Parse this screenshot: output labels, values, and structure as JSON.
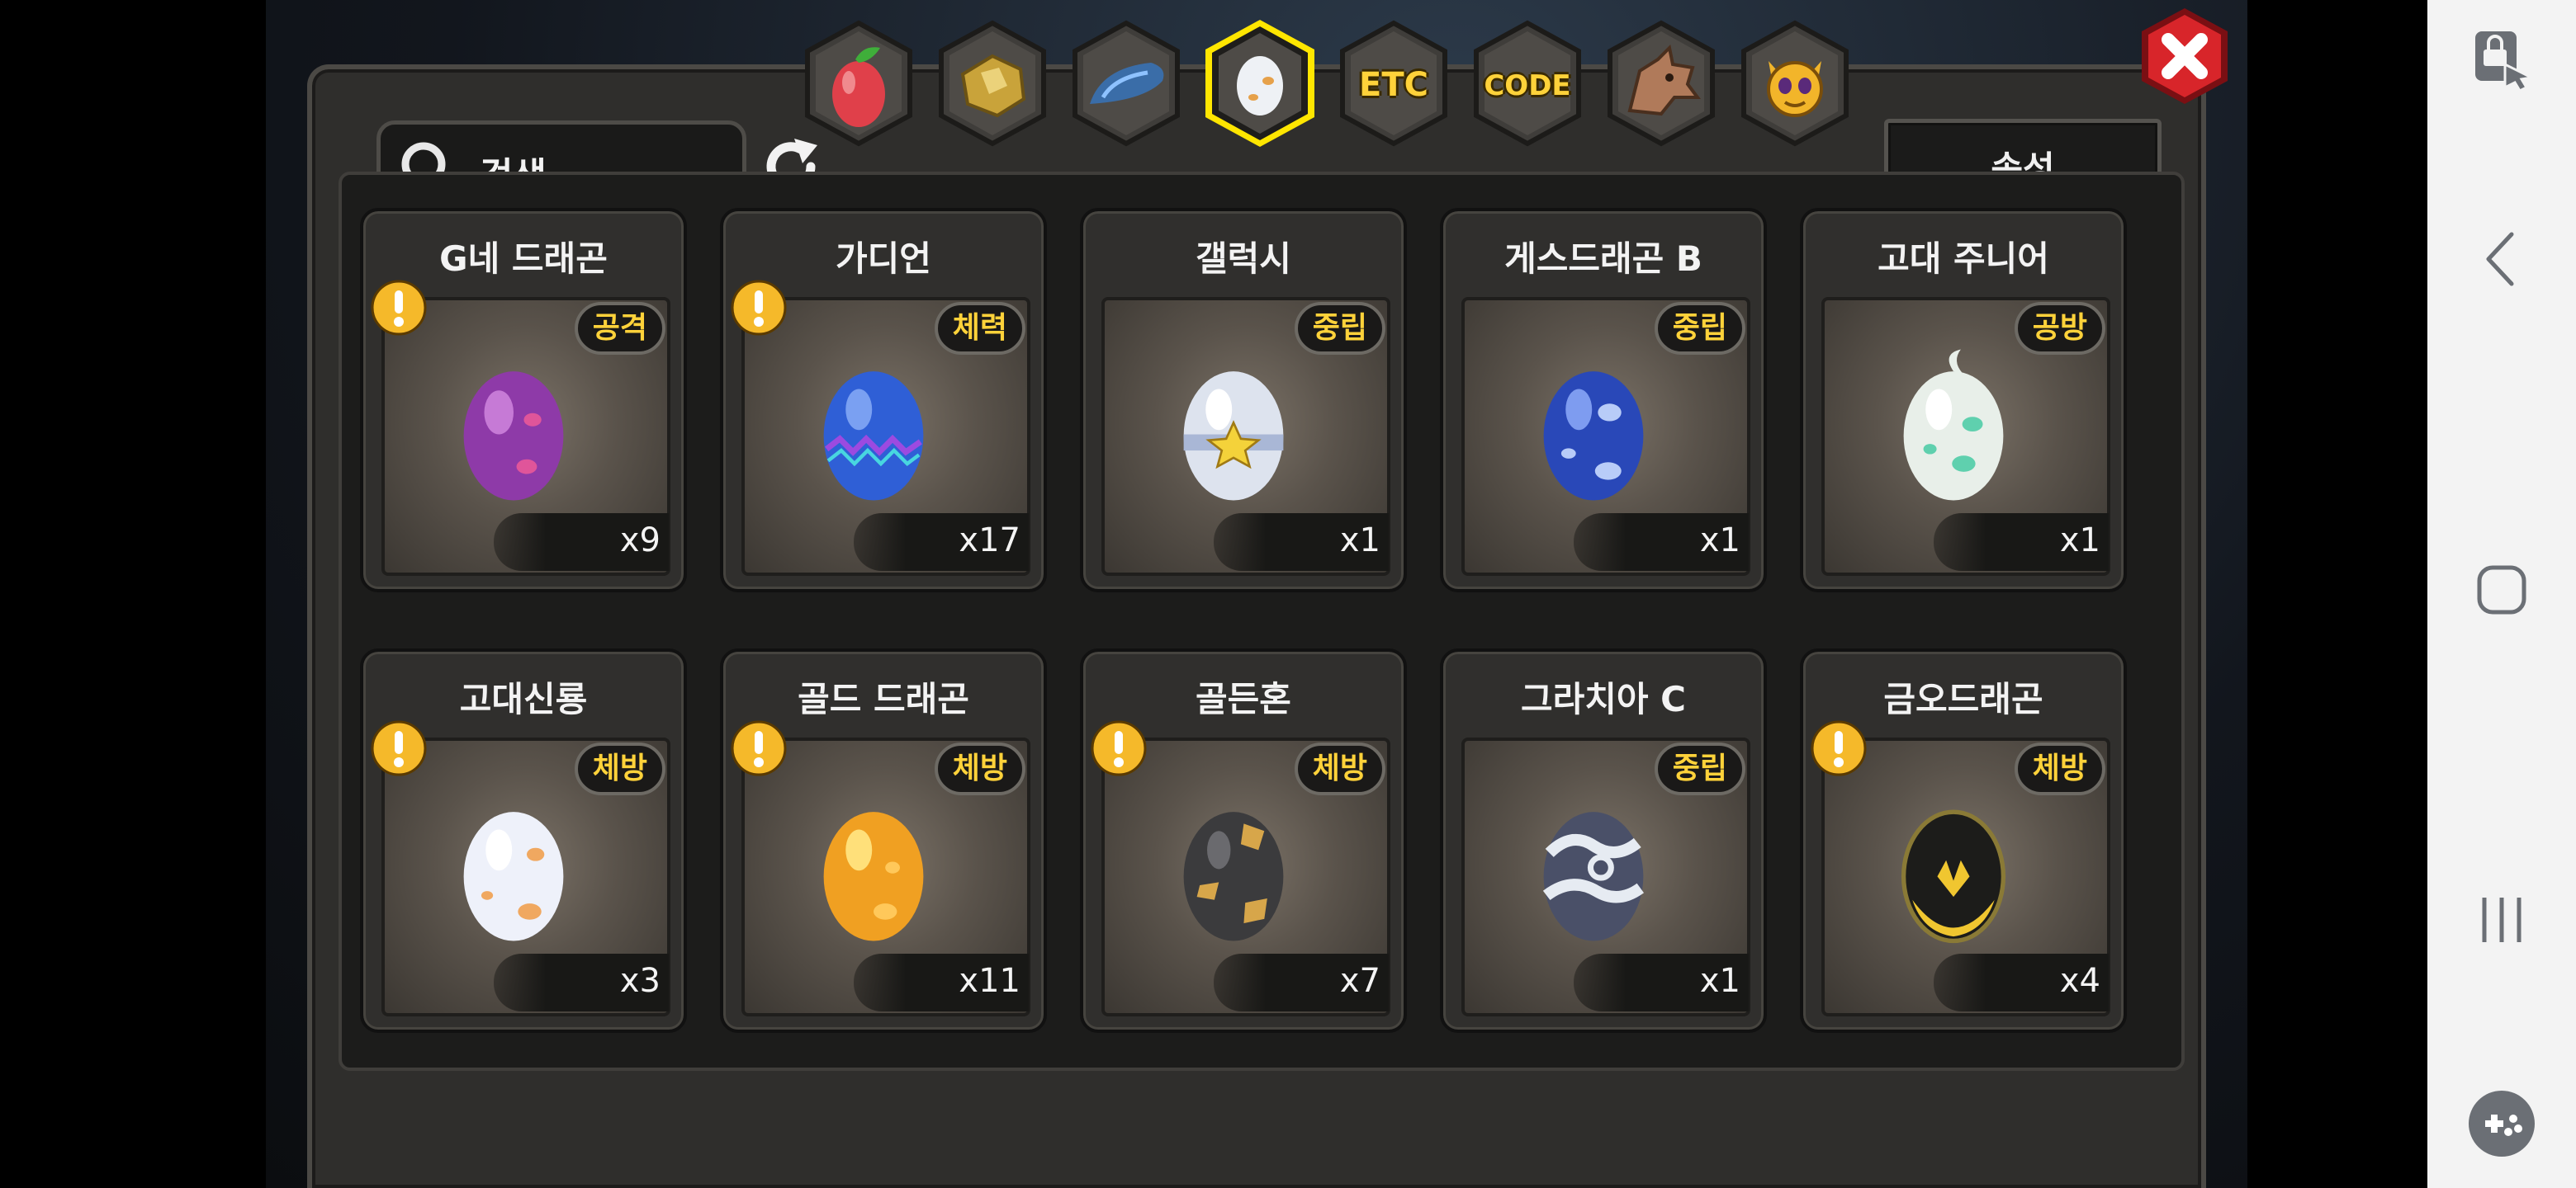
{
  "search": {
    "label": "검색"
  },
  "attribute_button": {
    "label": "속성"
  },
  "tabs": [
    {
      "name": "fruit",
      "icon": "fruit-icon",
      "selected": false
    },
    {
      "name": "gold-ore",
      "icon": "gold-nugget-icon",
      "selected": false
    },
    {
      "name": "dragon-scale",
      "icon": "dragon-scale-icon",
      "selected": false
    },
    {
      "name": "egg",
      "icon": "egg-icon",
      "selected": true
    },
    {
      "name": "etc",
      "label": "ETC",
      "selected": false
    },
    {
      "name": "code",
      "label": "CODE",
      "selected": false
    },
    {
      "name": "dragon",
      "icon": "dragon-head-icon",
      "selected": false
    },
    {
      "name": "mascot",
      "icon": "mascot-face-icon",
      "selected": false
    }
  ],
  "items": [
    {
      "name": "G네 드래곤",
      "attr": "공격",
      "count": "x9",
      "warning": true,
      "egg": "purple"
    },
    {
      "name": "가디언",
      "attr": "체력",
      "count": "x17",
      "warning": true,
      "egg": "blue-zigzag"
    },
    {
      "name": "갤럭시",
      "attr": "중립",
      "count": "x1",
      "warning": false,
      "egg": "white-star"
    },
    {
      "name": "게스드래곤 B",
      "attr": "중립",
      "count": "x1",
      "warning": false,
      "egg": "blue-spotted"
    },
    {
      "name": "고대 주니어",
      "attr": "공방",
      "count": "x1",
      "warning": false,
      "egg": "white-teal"
    },
    {
      "name": "고대신룡",
      "attr": "체방",
      "count": "x3",
      "warning": true,
      "egg": "white-orange"
    },
    {
      "name": "골드 드래곤",
      "attr": "체방",
      "count": "x11",
      "warning": true,
      "egg": "gold"
    },
    {
      "name": "골든혼",
      "attr": "체방",
      "count": "x7",
      "warning": true,
      "egg": "dark-gold"
    },
    {
      "name": "그라치아 C",
      "attr": "중립",
      "count": "x1",
      "warning": false,
      "egg": "silver-swirl"
    },
    {
      "name": "금오드래곤",
      "attr": "체방",
      "count": "x4",
      "warning": true,
      "egg": "black-gold"
    }
  ],
  "colors": {
    "badge_text": "#ffd23a",
    "warning": "#f5b92a",
    "close_button": "#d8252a",
    "selected_tab_ring": "#ffe600"
  }
}
